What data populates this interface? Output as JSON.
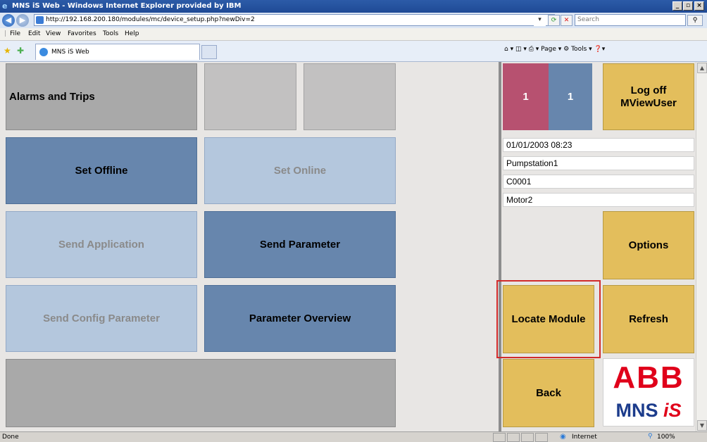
{
  "window": {
    "title": "MNS iS Web - Windows Internet Explorer provided by IBM",
    "minimize": "_",
    "maximize": "▫",
    "close": "×"
  },
  "browser": {
    "url": "http://192.168.200.180/modules/mc/device_setup.php?newDiv=2",
    "search_placeholder": "Search",
    "menu": [
      "File",
      "Edit",
      "View",
      "Favorites",
      "Tools",
      "Help"
    ],
    "tab_title": "MNS iS Web",
    "command_bar": "⌂ ▾  ◫ ▾  ⎙ ▾  Page ▾  ⚙ Tools ▾  ❓▾",
    "status_text": "Done",
    "zone": "Internet",
    "zoom": "100%"
  },
  "panel": {
    "alarms_label": "Alarms and Trips",
    "set_offline": "Set Offline",
    "set_online": "Set Online",
    "send_application": "Send Application",
    "send_parameter": "Send Parameter",
    "send_config_parameter": "Send Config Parameter",
    "parameter_overview": "Parameter Overview"
  },
  "side": {
    "counter_red": "1",
    "counter_blue": "1",
    "logoff_line1": "Log off",
    "logoff_line2": "MViewUser",
    "datetime": "01/01/2003 08:23",
    "station": "Pumpstation1",
    "device": "C0001",
    "motor": "Motor2",
    "options": "Options",
    "locate_module": "Locate Module",
    "refresh": "Refresh",
    "back": "Back"
  },
  "logo": {
    "abb": "ABB",
    "mns": "MNS",
    "is": "iS"
  },
  "colors": {
    "dark_blue": "#6786ad",
    "light_blue": "#b4c7dd",
    "gold": "#e3be5c",
    "counter_red": "#b75170",
    "counter_blue": "#6786ad",
    "highlight": "#d12b2b"
  }
}
